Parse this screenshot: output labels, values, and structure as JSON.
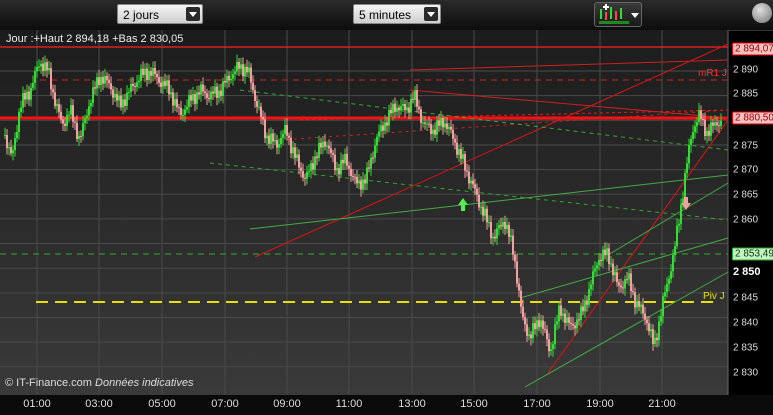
{
  "toolbar": {
    "period_select": "2 jours",
    "interval_select": "5 minutes"
  },
  "info_line": "Jour :+Haut 2 894,18 +Bas 2 830,05",
  "copyright": {
    "brand": "© IT-Finance.com",
    "note": "Données indicatives"
  },
  "levels": {
    "top_box": "2 894,07",
    "mid_box": "2 880,50",
    "low_box": "2 853,49",
    "current": "2 850",
    "mr1": "mR1 J",
    "pivot": "Piv J"
  },
  "y_ticks": [
    "2 890",
    "2 885",
    "2 875",
    "2 870",
    "2 865",
    "2 860",
    "2 845",
    "2 840",
    "2 835",
    "2 830"
  ],
  "x_ticks": [
    "01:00",
    "03:00",
    "05:00",
    "07:00",
    "09:00",
    "11:00",
    "13:00",
    "15:00",
    "17:00",
    "19:00",
    "21:00"
  ],
  "colors": {
    "up": "#33dd33",
    "down": "#f0a0a0",
    "resistance": "#ff2020",
    "support": "#44aa44",
    "pivot": "#e8e000",
    "background": "#000000"
  }
}
